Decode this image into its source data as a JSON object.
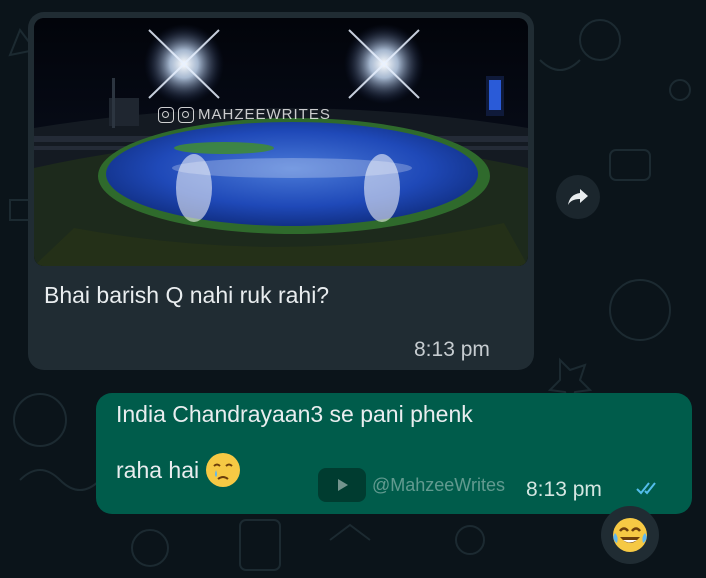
{
  "incoming": {
    "photo_watermark": "MAHZEEWRITES",
    "text": "Bhai barish Q nahi ruk rahi?",
    "time": "8:13 pm"
  },
  "outgoing": {
    "text_line1": "India Chandrayaan3 se pani phenk",
    "text_line2": "raha hai",
    "inline_emoji": "face-holding-back-tears",
    "watermark": "@MahzeeWrites",
    "time": "8:13 pm",
    "status": "read",
    "reaction": "face-with-tears-of-joy"
  },
  "colors": {
    "background": "#0b141a",
    "incoming_bubble": "#202c33",
    "outgoing_bubble": "#005c4b",
    "read_ticks": "#53bdeb"
  }
}
